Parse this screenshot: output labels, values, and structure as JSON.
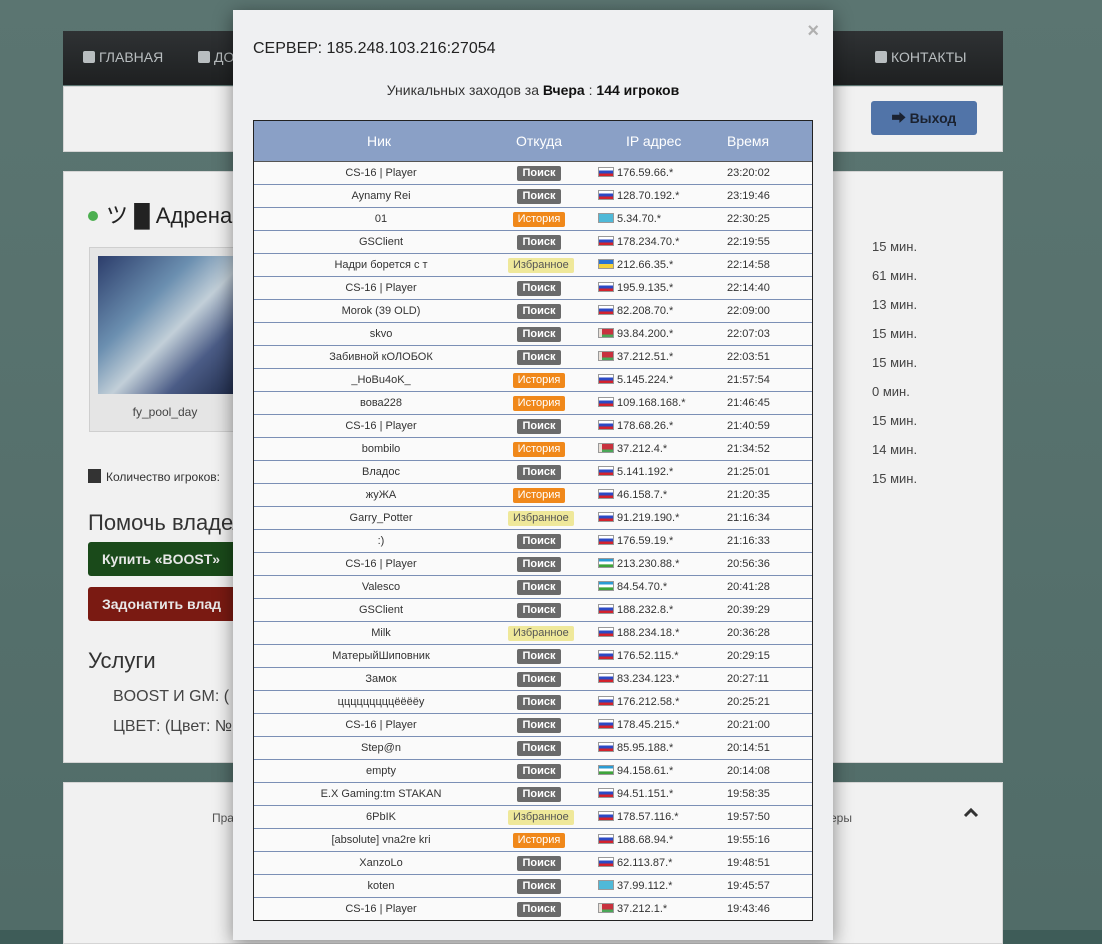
{
  "nav": {
    "home": "ГЛАВНАЯ",
    "add_partial": "ДО",
    "contacts": "КОНТАКТЫ"
  },
  "header": {
    "exit_label": "Выход"
  },
  "server": {
    "name_partial": "ツ █ Адрена",
    "map_name": "fy_pool_day",
    "players_label": "Количество игроков:"
  },
  "times": [
    "15 мин.",
    "61 мин.",
    "13 мин.",
    "15 мин.",
    "15 мин.",
    "0 мин.",
    "15 мин.",
    "14 мин.",
    "15 мин."
  ],
  "help": {
    "title": "Помочь владел",
    "boost_label": "Купить «BOOST»",
    "donate_label": "Задонатить влад"
  },
  "services": {
    "title": "Услуги",
    "boost_row": "BOOST И GM:   (",
    "color_row": "ЦВЕТ:   (Цвет: №"
  },
  "footer": {
    "left": "Пра",
    "right": "еры"
  },
  "modal": {
    "close": "×",
    "title": "СЕРВЕР: 185.248.103.216:27054",
    "subtitle_prefix": "Уникальных заходов за ",
    "subtitle_day": "Вчера",
    "subtitle_sep": " : ",
    "subtitle_count": "144 игроков",
    "columns": {
      "nick": "Ник",
      "source": "Откуда",
      "ip": "IP адрес",
      "time": "Время"
    },
    "rows": [
      {
        "nick": "CS-16 | Player",
        "src": "Поиск",
        "type": "search",
        "flag": "ru",
        "ip": "176.59.66.*",
        "time": "23:20:02"
      },
      {
        "nick": "Aynamy Rei",
        "src": "Поиск",
        "type": "search",
        "flag": "ru",
        "ip": "128.70.192.*",
        "time": "23:19:46"
      },
      {
        "nick": "01",
        "src": "История",
        "type": "hist",
        "flag": "kz",
        "ip": "5.34.70.*",
        "time": "22:30:25"
      },
      {
        "nick": "GSClient",
        "src": "Поиск",
        "type": "search",
        "flag": "ru",
        "ip": "178.234.70.*",
        "time": "22:19:55"
      },
      {
        "nick": "Надри борется с т",
        "src": "Избранное",
        "type": "fav",
        "flag": "ua",
        "ip": "212.66.35.*",
        "time": "22:14:58"
      },
      {
        "nick": "CS-16 | Player",
        "src": "Поиск",
        "type": "search",
        "flag": "ru",
        "ip": "195.9.135.*",
        "time": "22:14:40"
      },
      {
        "nick": "Morok (39 OLD)",
        "src": "Поиск",
        "type": "search",
        "flag": "ru",
        "ip": "82.208.70.*",
        "time": "22:09:00"
      },
      {
        "nick": "skvo",
        "src": "Поиск",
        "type": "search",
        "flag": "by",
        "ip": "93.84.200.*",
        "time": "22:07:03"
      },
      {
        "nick": "Забивной кОЛОБОК",
        "src": "Поиск",
        "type": "search",
        "flag": "by",
        "ip": "37.212.51.*",
        "time": "22:03:51"
      },
      {
        "nick": "_HoBu4oK_",
        "src": "История",
        "type": "hist",
        "flag": "ru",
        "ip": "5.145.224.*",
        "time": "21:57:54"
      },
      {
        "nick": "вова228",
        "src": "История",
        "type": "hist",
        "flag": "ru",
        "ip": "109.168.168.*",
        "time": "21:46:45"
      },
      {
        "nick": "CS-16 | Player",
        "src": "Поиск",
        "type": "search",
        "flag": "ru",
        "ip": "178.68.26.*",
        "time": "21:40:59"
      },
      {
        "nick": "bombilo",
        "src": "История",
        "type": "hist",
        "flag": "by",
        "ip": "37.212.4.*",
        "time": "21:34:52"
      },
      {
        "nick": "Владос",
        "src": "Поиск",
        "type": "search",
        "flag": "ru",
        "ip": "5.141.192.*",
        "time": "21:25:01"
      },
      {
        "nick": "жуЖА",
        "src": "История",
        "type": "hist",
        "flag": "ru",
        "ip": "46.158.7.*",
        "time": "21:20:35"
      },
      {
        "nick": "Garry_Potter",
        "src": "Избранное",
        "type": "fav",
        "flag": "ru",
        "ip": "91.219.190.*",
        "time": "21:16:34"
      },
      {
        "nick": ":)",
        "src": "Поиск",
        "type": "search",
        "flag": "ru",
        "ip": "176.59.19.*",
        "time": "21:16:33"
      },
      {
        "nick": "CS-16 | Player",
        "src": "Поиск",
        "type": "search",
        "flag": "uz",
        "ip": "213.230.88.*",
        "time": "20:56:36"
      },
      {
        "nick": "Valesco",
        "src": "Поиск",
        "type": "search",
        "flag": "uz",
        "ip": "84.54.70.*",
        "time": "20:41:28"
      },
      {
        "nick": "GSClient",
        "src": "Поиск",
        "type": "search",
        "flag": "ru",
        "ip": "188.232.8.*",
        "time": "20:39:29"
      },
      {
        "nick": "Milk",
        "src": "Избранное",
        "type": "fav",
        "flag": "ru",
        "ip": "188.234.18.*",
        "time": "20:36:28"
      },
      {
        "nick": "МатерыйШиповник",
        "src": "Поиск",
        "type": "search",
        "flag": "ru",
        "ip": "176.52.115.*",
        "time": "20:29:15"
      },
      {
        "nick": "Замок",
        "src": "Поиск",
        "type": "search",
        "flag": "ru",
        "ip": "83.234.123.*",
        "time": "20:27:11"
      },
      {
        "nick": "цццццццццёёёёу",
        "src": "Поиск",
        "type": "search",
        "flag": "ru",
        "ip": "176.212.58.*",
        "time": "20:25:21"
      },
      {
        "nick": "CS-16 | Player",
        "src": "Поиск",
        "type": "search",
        "flag": "ru",
        "ip": "178.45.215.*",
        "time": "20:21:00"
      },
      {
        "nick": "Step@n",
        "src": "Поиск",
        "type": "search",
        "flag": "ru",
        "ip": "85.95.188.*",
        "time": "20:14:51"
      },
      {
        "nick": "empty",
        "src": "Поиск",
        "type": "search",
        "flag": "uz",
        "ip": "94.158.61.*",
        "time": "20:14:08"
      },
      {
        "nick": "E.X Gaming:tm STAKAN",
        "src": "Поиск",
        "type": "search",
        "flag": "ru",
        "ip": "94.51.151.*",
        "time": "19:58:35"
      },
      {
        "nick": "6PbIK",
        "src": "Избранное",
        "type": "fav",
        "flag": "ru",
        "ip": "178.57.116.*",
        "time": "19:57:50"
      },
      {
        "nick": "[absolute] vna2re kri",
        "src": "История",
        "type": "hist",
        "flag": "ru",
        "ip": "188.68.94.*",
        "time": "19:55:16"
      },
      {
        "nick": "XanzoLo",
        "src": "Поиск",
        "type": "search",
        "flag": "ru",
        "ip": "62.113.87.*",
        "time": "19:48:51"
      },
      {
        "nick": "koten",
        "src": "Поиск",
        "type": "search",
        "flag": "kz",
        "ip": "37.99.112.*",
        "time": "19:45:57"
      },
      {
        "nick": "CS-16 | Player",
        "src": "Поиск",
        "type": "search",
        "flag": "by",
        "ip": "37.212.1.*",
        "time": "19:43:46"
      }
    ]
  }
}
